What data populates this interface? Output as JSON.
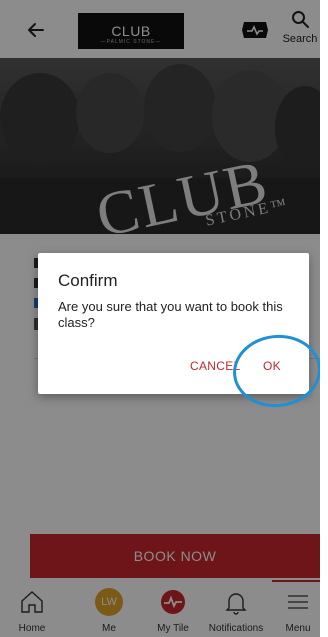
{
  "header": {
    "logo_text": "CLUB",
    "logo_sub": "—PALMIC STONE—",
    "search_label": "Search"
  },
  "hero": {
    "text": "CLUB",
    "sub": "STONE™"
  },
  "dialog": {
    "title": "Confirm",
    "message": "Are you sure that you want to book this class?",
    "cancel_label": "CANCEL",
    "ok_label": "OK"
  },
  "book_now_label": "BOOK NOW",
  "nav": {
    "items": [
      {
        "label": "Home"
      },
      {
        "label": "Me",
        "avatar_initials": "LW"
      },
      {
        "label": "My Tile"
      },
      {
        "label": "Notifications"
      },
      {
        "label": "Menu"
      }
    ]
  },
  "colors": {
    "brand_red": "#c6272c",
    "avatar_orange": "#e0a32b",
    "highlight_blue": "#1e90d6"
  }
}
